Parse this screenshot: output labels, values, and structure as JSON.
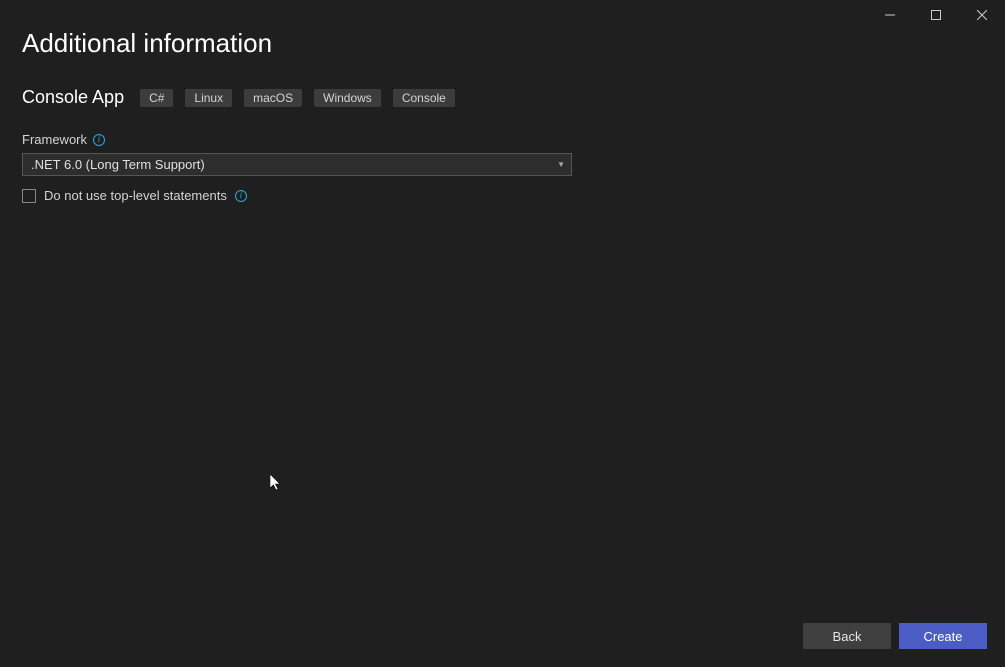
{
  "header": {
    "title": "Additional information"
  },
  "project": {
    "name": "Console App",
    "tags": [
      "C#",
      "Linux",
      "macOS",
      "Windows",
      "Console"
    ]
  },
  "framework": {
    "label": "Framework",
    "selected": ".NET 6.0 (Long Term Support)"
  },
  "options": {
    "topLevelStatementsLabel": "Do not use top-level statements"
  },
  "footer": {
    "back": "Back",
    "create": "Create"
  }
}
